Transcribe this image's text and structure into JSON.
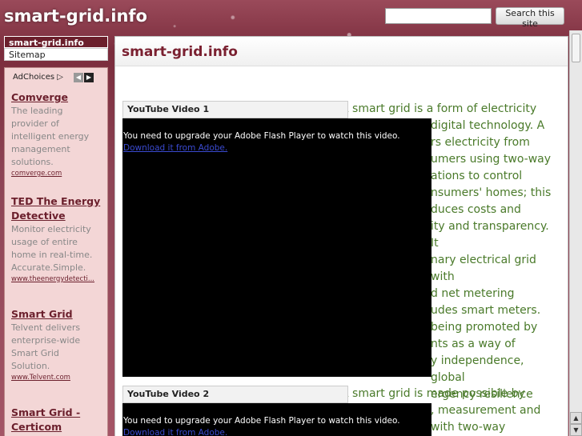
{
  "header": {
    "site_title": "smart-grid.info",
    "search_placeholder": "",
    "search_button": "Search this site"
  },
  "nav": {
    "items": [
      {
        "label": "smart-grid.info",
        "active": true
      },
      {
        "label": "Sitemap",
        "active": false
      }
    ]
  },
  "sidebar": {
    "adchoices_label": "AdChoices ▷",
    "prev_icon": "◀",
    "next_icon": "▶",
    "ads": [
      {
        "title": "Comverge",
        "lines": [
          "The leading",
          "provider of",
          "intelligent energy",
          "management",
          "solutions."
        ],
        "url": "comverge.com"
      },
      {
        "title_lines": [
          "TED The Energy",
          "Detective"
        ],
        "lines": [
          "Monitor electricity",
          "usage of entire",
          "home in real-time.",
          "Accurate.Simple."
        ],
        "url": "www.theenergydetecti..."
      },
      {
        "title": "Smart Grid",
        "lines": [
          "Telvent delivers",
          "enterprise-wide",
          "Smart Grid",
          "Solution."
        ],
        "url": "www.Telvent.com"
      },
      {
        "title_lines": [
          "Smart Grid -",
          "Certicom"
        ]
      }
    ]
  },
  "main": {
    "page_title": "smart-grid.info",
    "videos": [
      {
        "header": "YouTube Video 1",
        "flash_message": "You need to upgrade your Adobe Flash Player to watch this video.",
        "flash_link": "Download it from Adobe."
      },
      {
        "header": "YouTube Video 2",
        "flash_message": "You need to upgrade your Adobe Flash Player to watch this video.",
        "flash_link": "Download it from Adobe."
      }
    ],
    "article1_lines": [
      "A smart grid is a form of electricity",
      "digital technology. A",
      "rs electricity from",
      "umers using two-way",
      "ations to control",
      "nsumers' homes; this",
      "duces costs and",
      "ity and transparency. It",
      "nary electrical grid with",
      "d net metering",
      "udes smart meters.",
      "being promoted by",
      "nts as a way of",
      "y independence, global",
      "ergency resilience"
    ],
    "article2_lines": [
      "A smart grid is made possible by",
      ", measurement and",
      "with two-way"
    ]
  },
  "scrollbar": {
    "up_icon": "▲",
    "down_icon": "▼"
  },
  "colors": {
    "accent": "#7a2030",
    "article_text": "#4a7a2a",
    "sidebar_bg": "#f3d6d6"
  }
}
